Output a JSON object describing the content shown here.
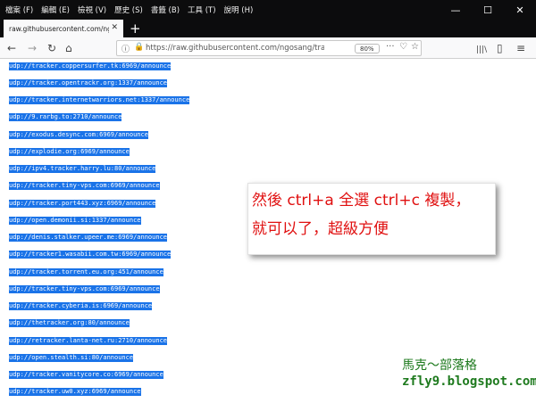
{
  "menubar": {
    "items": [
      "檔案 (F)",
      "編輯 (E)",
      "檢視 (V)",
      "歷史 (S)",
      "書籤 (B)",
      "工具 (T)",
      "說明 (H)"
    ],
    "minimize": "—",
    "maximize": "☐",
    "close": "✕"
  },
  "tab": {
    "title": "raw.githubusercontent.com/ngos",
    "close": "✕",
    "new_tab": "+"
  },
  "navbar": {
    "back": "←",
    "forward": "→",
    "reload": "↻",
    "home": "⌂",
    "info": "ⓘ",
    "lock": "🔒",
    "url": "https://raw.githubusercontent.com/ngosang/trac",
    "zoom": "80%",
    "more": "···",
    "pocket": "♡",
    "star": "☆",
    "library": "|||\\",
    "sidebar": "▯",
    "menu": "≡"
  },
  "trackers": [
    "udp://tracker.coppersurfer.tk:6969/announce",
    "udp://tracker.opentrackr.org:1337/announce",
    "udp://tracker.internetwarriors.net:1337/announce",
    "udp://9.rarbg.to:2710/announce",
    "udp://exodus.desync.com:6969/announce",
    "udp://explodie.org:6969/announce",
    "udp://ipv4.tracker.harry.lu:80/announce",
    "udp://tracker.tiny-vps.com:6969/announce",
    "udp://tracker.port443.xyz:6969/announce",
    "udp://open.demonii.si:1337/announce",
    "udp://denis.stalker.upeer.me:6969/announce",
    "udp://tracker1.wasabii.com.tw:6969/announce",
    "udp://tracker.torrent.eu.org:451/announce",
    "udp://tracker.tiny-vps.com:6969/announce",
    "udp://tracker.cyberia.is:6969/announce",
    "udp://thetracker.org:80/announce",
    "udp://retracker.lanta-net.ru:2710/announce",
    "udp://open.stealth.si:80/announce",
    "udp://tracker.vanitycore.co:6969/announce",
    "udp://tracker.uw0.xyz:6969/announce"
  ],
  "note": {
    "line1": "然後 ctrl+a 全選 ctrl+c 複製，",
    "line2": "就可以了，超級方便"
  },
  "watermark": {
    "name": "馬克～部落格",
    "url": "zfly9.blogspot.com"
  },
  "colors": {
    "selection": "#1a73e8",
    "note_text": "#e01010",
    "watermark": "#1e7a1e"
  }
}
